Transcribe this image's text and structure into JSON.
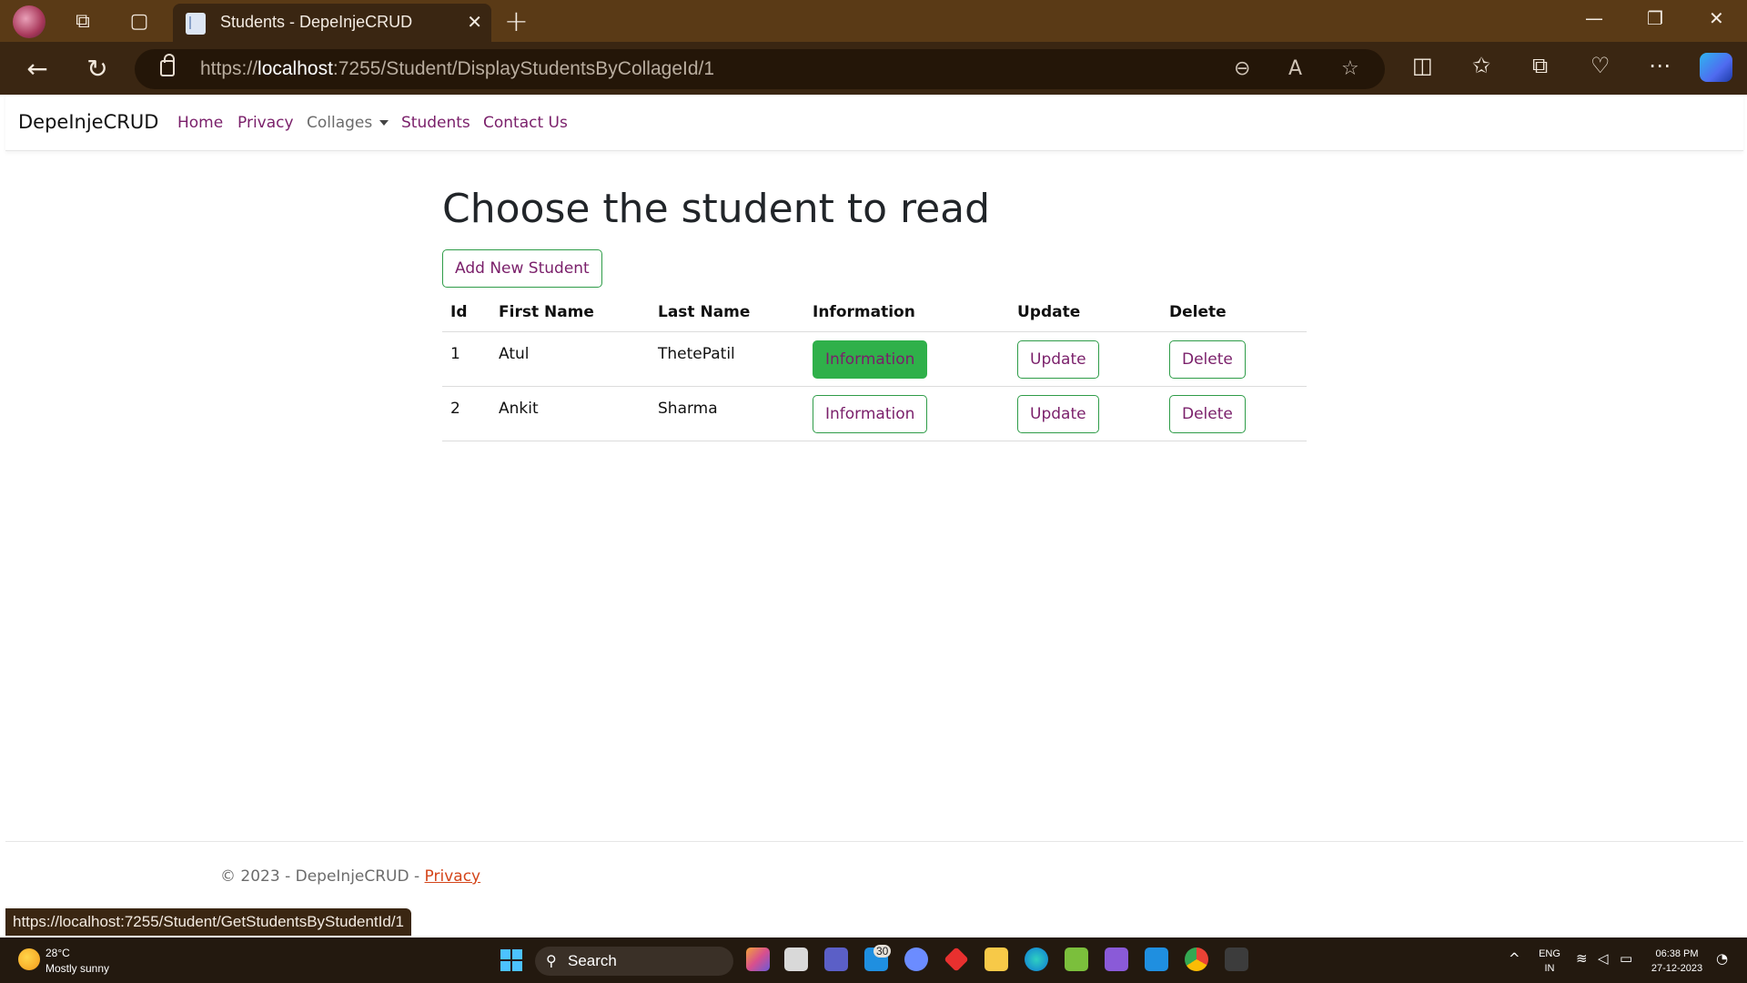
{
  "browser": {
    "tab_title": "Students - DepeInjeCRUD",
    "url_scheme": "https://",
    "url_host": "localhost",
    "url_path": ":7255/Student/DisplayStudentsByCollageId/1",
    "status_url": "https://localhost:7255/Student/GetStudentsByStudentId/1"
  },
  "navbar": {
    "brand": "DepeInjeCRUD",
    "links": [
      "Home",
      "Privacy",
      "Collages",
      "Students",
      "Contact Us"
    ]
  },
  "main": {
    "heading": "Choose the student to read",
    "add_button": "Add New Student",
    "table": {
      "headers": [
        "Id",
        "First Name",
        "Last Name",
        "Information",
        "Update",
        "Delete"
      ],
      "rows": [
        {
          "id": "1",
          "first_name": "Atul",
          "last_name": "ThetePatil",
          "info_label": "Information",
          "update_label": "Update",
          "delete_label": "Delete",
          "info_active": true
        },
        {
          "id": "2",
          "first_name": "Ankit",
          "last_name": "Sharma",
          "info_label": "Information",
          "update_label": "Update",
          "delete_label": "Delete",
          "info_active": false
        }
      ]
    }
  },
  "footer": {
    "text": "© 2023 - DepeInjeCRUD - ",
    "link": "Privacy"
  },
  "taskbar": {
    "weather_temp": "28°C",
    "weather_desc": "Mostly sunny",
    "search_label": "Search",
    "mail_badge": "30",
    "lang_top": "ENG",
    "lang_bottom": "IN",
    "time": "06:38 PM",
    "date": "27-12-2023"
  },
  "colors": {
    "link": "#7a1f6a",
    "button_border": "#2e9c48",
    "button_active": "#2fb04a",
    "titlebar": "#5a3a16"
  }
}
